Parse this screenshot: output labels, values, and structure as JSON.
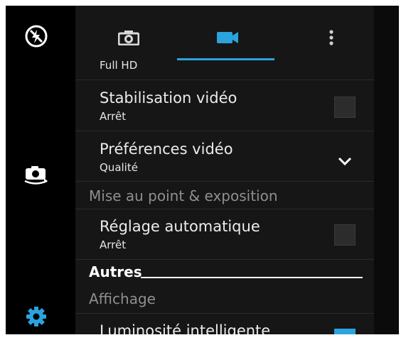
{
  "icons": {
    "flash": "flash-off-icon",
    "switch_camera": "switch-camera-icon",
    "settings": "gear-icon",
    "camera_tab": "camera-icon",
    "video_tab": "video-camera-icon",
    "more": "more-vertical-icon",
    "chevron": "chevron-down-icon"
  },
  "colors": {
    "accent": "#2aa3de",
    "panel_bg": "#161616",
    "rail_bg": "#000000",
    "icon": "#ffffff"
  },
  "settings_list": {
    "video_size_value": "Full HD",
    "stabilization": {
      "title": "Stabilisation vidéo",
      "value": "Arrêt",
      "checked": false
    },
    "video_prefs": {
      "title": "Préférences vidéo",
      "value": "Qualité"
    },
    "section_focus": "Mise au point & exposition",
    "auto_adjust": {
      "title": "Réglage automatique",
      "value": "Arrêt",
      "checked": false
    },
    "section_others": "Autres",
    "section_display": "Affichage",
    "smart_brightness": {
      "title": "Luminosité intelligente",
      "checked": true
    }
  }
}
